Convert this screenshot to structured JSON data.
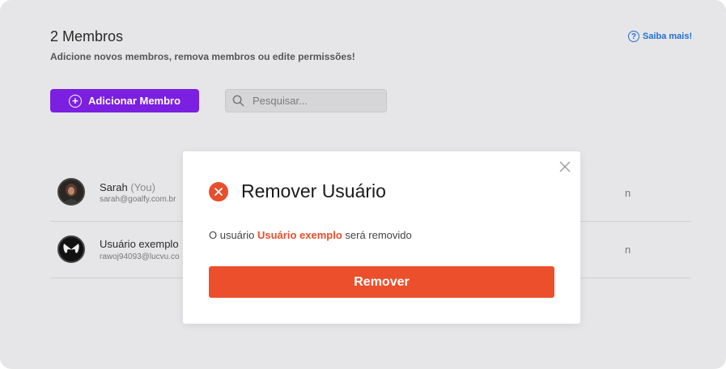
{
  "header": {
    "title": "2 Membros",
    "subtitle": "Adicione novos membros, remova membros ou edite permissões!",
    "help_label": "Saiba mais!",
    "help_icon": "question-circle-icon"
  },
  "toolbar": {
    "add_member_label": "Adicionar Membro",
    "search_placeholder": "Pesquisar..."
  },
  "members": [
    {
      "name": "Sarah",
      "tag": "(You)",
      "email": "sarah@goalfy.com.br"
    },
    {
      "name": "Usuário exemplo",
      "tag": "",
      "email": "rawoj94093@lucvu.co"
    }
  ],
  "modal": {
    "title": "Remover Usuário",
    "message_prefix": "O usuário",
    "message_user": "Usuário exemplo",
    "message_suffix": "será removido",
    "confirm_label": "Remover"
  },
  "colors": {
    "accent_purple": "#7b1fe0",
    "danger": "#ec4f2c",
    "link_blue": "#1f6fd6"
  }
}
